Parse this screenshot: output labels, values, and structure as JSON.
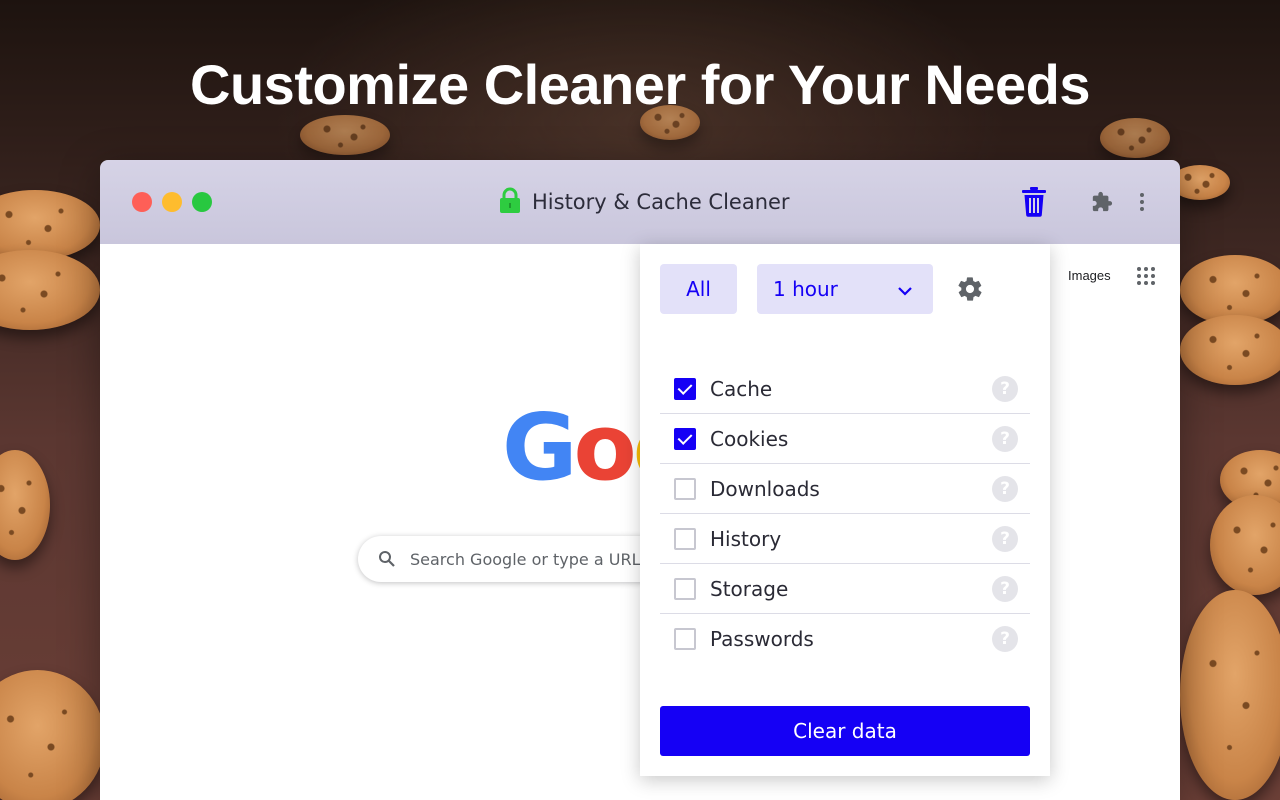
{
  "headline": "Customize Cleaner for Your Needs",
  "window": {
    "title": "History & Cache Cleaner",
    "title_icon": "lock-icon",
    "toolbar_icons": [
      "trash-icon",
      "puzzle-icon",
      "more-vert-icon"
    ]
  },
  "browser_page": {
    "images_link": "Images",
    "logo_text_visible": "Goo",
    "search_placeholder": "Search Google or type a URL"
  },
  "popup": {
    "all_button": "All",
    "time_range": {
      "selected": "1 hour"
    },
    "options": [
      {
        "label": "Cache",
        "checked": true
      },
      {
        "label": "Cookies",
        "checked": true
      },
      {
        "label": "Downloads",
        "checked": false
      },
      {
        "label": "History",
        "checked": false
      },
      {
        "label": "Storage",
        "checked": false
      },
      {
        "label": "Passwords",
        "checked": false
      }
    ],
    "help_glyph": "?",
    "clear_button": "Clear data"
  },
  "colors": {
    "accent": "#1500f5",
    "accent_light": "#e3e1f9",
    "titlebar": "#d6d3e6",
    "lock": "#2ecc40",
    "traffic_red": "#fe5f57",
    "traffic_yellow": "#febc2e",
    "traffic_green": "#28c840"
  }
}
